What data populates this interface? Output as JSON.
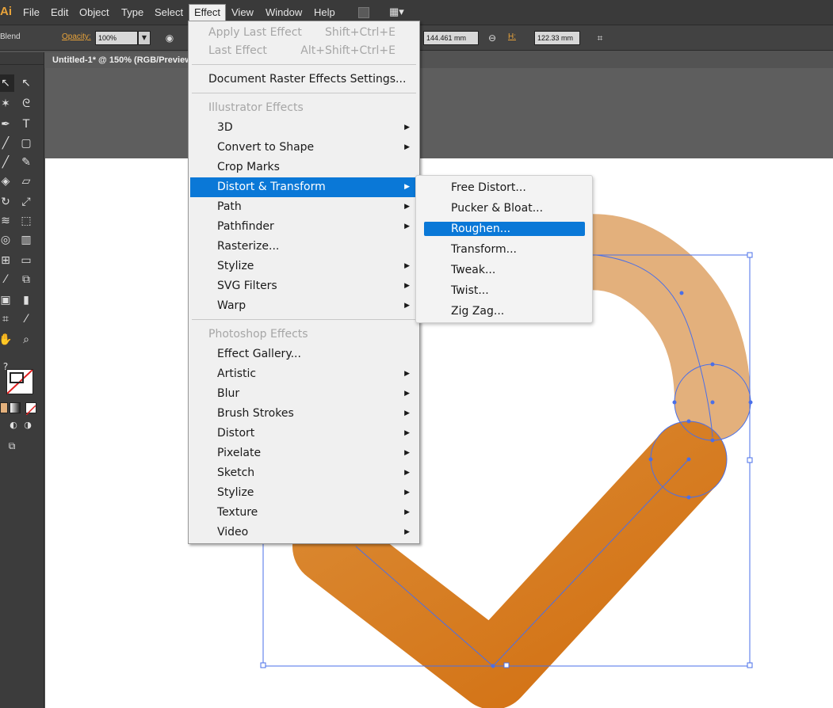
{
  "app": {
    "logo": "Ai",
    "menu": [
      "File",
      "Edit",
      "Object",
      "Type",
      "Select",
      "Effect",
      "View",
      "Window",
      "Help"
    ],
    "active_menu": "Effect"
  },
  "control_bar": {
    "blend_label": "Blend",
    "opacity_label": "Opacity:",
    "opacity_value": "100%",
    "w_value": "144.461 mm",
    "h_label": "H:",
    "h_value": "122.33 mm"
  },
  "document": {
    "tab_title": "Untitled-1* @ 150% (RGB/Preview)"
  },
  "effect_menu": {
    "apply_last": {
      "label": "Apply Last Effect",
      "shortcut": "Shift+Ctrl+E"
    },
    "last": {
      "label": "Last Effect",
      "shortcut": "Alt+Shift+Ctrl+E"
    },
    "doc_raster": "Document Raster Effects Settings...",
    "illustrator_header": "Illustrator Effects",
    "illustrator_items": [
      "3D",
      "Convert to Shape",
      "Crop Marks",
      "Distort & Transform",
      "Path",
      "Pathfinder",
      "Rasterize...",
      "Stylize",
      "SVG Filters",
      "Warp"
    ],
    "photoshop_header": "Photoshop Effects",
    "photoshop_items": [
      "Effect Gallery...",
      "Artistic",
      "Blur",
      "Brush Strokes",
      "Distort",
      "Pixelate",
      "Sketch",
      "Stylize",
      "Texture",
      "Video"
    ],
    "highlighted": "Distort & Transform"
  },
  "submenu": {
    "items": [
      "Free Distort...",
      "Pucker & Bloat...",
      "Roughen...",
      "Transform...",
      "Tweak...",
      "Twist...",
      "Zig Zag..."
    ],
    "highlighted": "Roughen..."
  },
  "colors": {
    "menu_highlight": "#0a78d7",
    "stroke_light": "#e3b07c",
    "stroke_dark": "#d4740c",
    "selection": "#4a6fe8"
  }
}
